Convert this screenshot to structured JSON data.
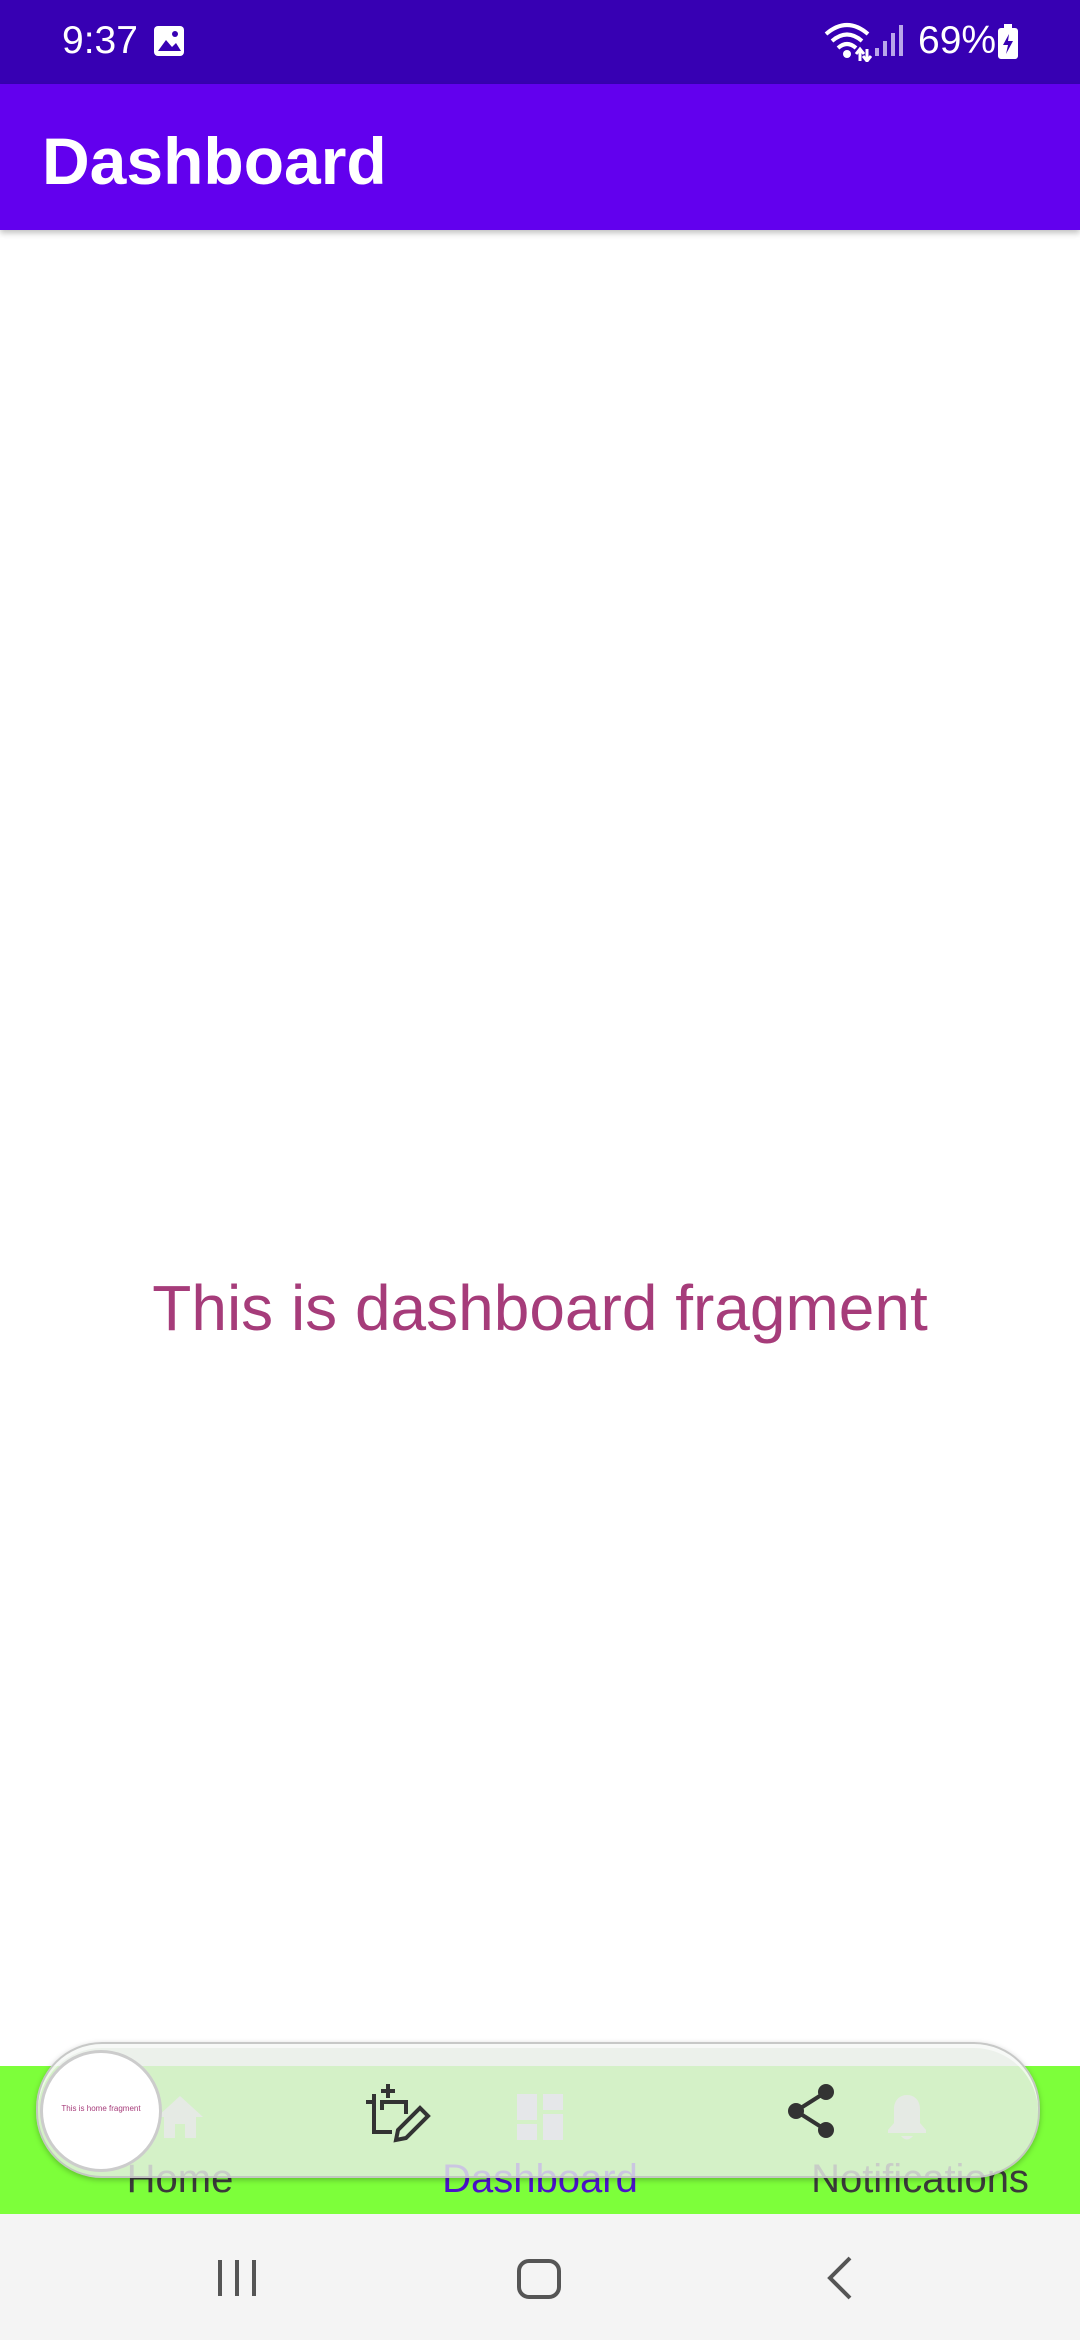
{
  "status_bar": {
    "time": "9:37",
    "battery": "69%",
    "icons": [
      "gallery-icon",
      "wifi-icon",
      "signal-icon",
      "battery-charging-icon"
    ]
  },
  "app_bar": {
    "title": "Dashboard",
    "color": "#6200ee"
  },
  "main": {
    "fragment_text": "This is dashboard fragment",
    "text_color": "#a63c7a"
  },
  "bottom_nav": {
    "background": "#7dff3a",
    "selected": "Dashboard",
    "items": [
      {
        "label": "Home",
        "icon": "home-icon"
      },
      {
        "label": "Dashboard",
        "icon": "dashboard-icon"
      },
      {
        "label": "Notifications",
        "icon": "bell-icon"
      }
    ]
  },
  "floating_bar": {
    "thumbnail_text": "This is home fragment",
    "icons": [
      "crop-edit-icon",
      "share-icon"
    ]
  },
  "system_nav": {
    "icons": [
      "recents-icon",
      "home-button-icon",
      "back-icon"
    ]
  }
}
